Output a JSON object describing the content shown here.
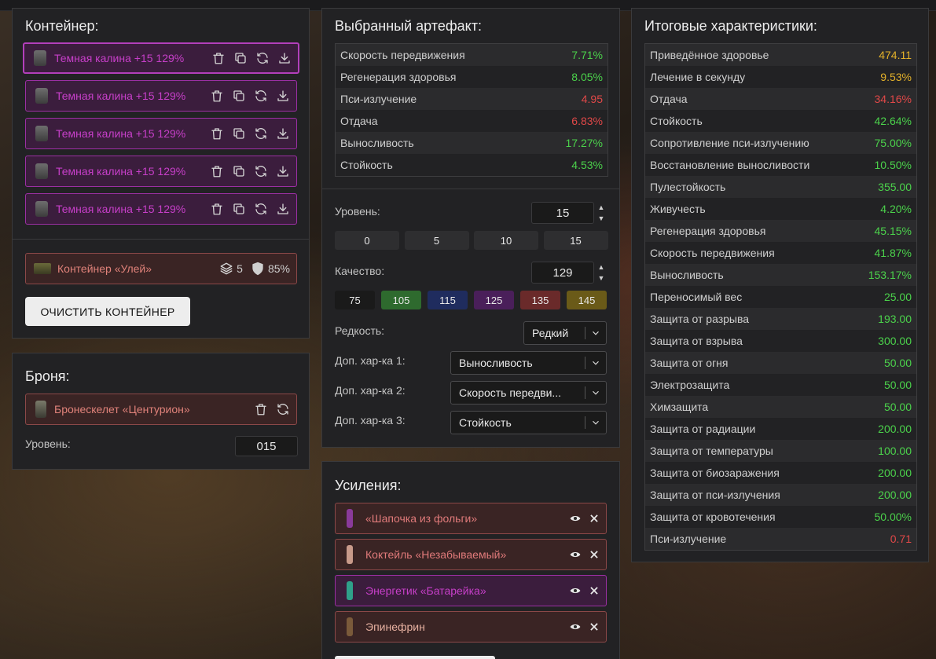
{
  "container": {
    "title": "Контейнер:",
    "items": [
      {
        "name": "Темная калина +15 129%"
      },
      {
        "name": "Темная калина +15 129%"
      },
      {
        "name": "Темная калина +15 129%"
      },
      {
        "name": "Темная калина +15 129%"
      },
      {
        "name": "Темная калина +15 129%"
      }
    ],
    "container_name": "Контейнер «Улей»",
    "slots": "5",
    "protection": "85%",
    "clear_button": "ОЧИСТИТЬ КОНТЕЙНЕР"
  },
  "armor": {
    "title": "Броня:",
    "name": "Бронескелет «Центурион»",
    "level_label": "Уровень:",
    "level_value": "015"
  },
  "artifact": {
    "title": "Выбранный артефакт:",
    "stats": [
      {
        "label": "Скорость передвижения",
        "value": "7.71%",
        "color": "green"
      },
      {
        "label": "Регенерация здоровья",
        "value": "8.05%",
        "color": "green"
      },
      {
        "label": "Пси-излучение",
        "value": "4.95",
        "color": "red"
      },
      {
        "label": "Отдача",
        "value": "6.83%",
        "color": "red"
      },
      {
        "label": "Выносливость",
        "value": "17.27%",
        "color": "green"
      },
      {
        "label": "Стойкость",
        "value": "4.53%",
        "color": "green"
      }
    ],
    "level_label": "Уровень:",
    "level_value": "15",
    "level_presets": [
      "0",
      "5",
      "10",
      "15"
    ],
    "quality_label": "Качество:",
    "quality_value": "129",
    "quality_presets": [
      {
        "label": "75",
        "color": "#1a1a1a"
      },
      {
        "label": "105",
        "color": "#2e6a2e"
      },
      {
        "label": "115",
        "color": "#1f2c5e"
      },
      {
        "label": "125",
        "color": "#4a1f5a"
      },
      {
        "label": "135",
        "color": "#6a2a2a"
      },
      {
        "label": "145",
        "color": "#6a5a18"
      }
    ],
    "rarity_label": "Редкость:",
    "rarity_value": "Редкий",
    "extra1_label": "Доп. хар-ка 1:",
    "extra1_value": "Выносливость",
    "extra2_label": "Доп. хар-ка 2:",
    "extra2_value": "Скорость передви...",
    "extra3_label": "Доп. хар-ка 3:",
    "extra3_value": "Стойкость"
  },
  "boosts": {
    "title": "Усиления:",
    "items": [
      {
        "name": "«Шапочка из фольги»",
        "bg": "#3a2424",
        "border": "#8b4848",
        "text": "#e07a7a",
        "thumb": "#8a3a9a"
      },
      {
        "name": "Коктейль «Незабываемый»",
        "bg": "#3a2424",
        "border": "#8b4848",
        "text": "#e07a7a",
        "thumb": "#c89a8a"
      },
      {
        "name": "Энергетик «Батарейка»",
        "bg": "#3b1d3d",
        "border": "#9b2fa3",
        "text": "#c73fc9",
        "thumb": "#2fa08a"
      },
      {
        "name": "Эпинефрин",
        "bg": "#3a2424",
        "border": "#8b4848",
        "text": "#e6b0a0",
        "thumb": "#7a5a3a"
      }
    ]
  },
  "totals": {
    "title": "Итоговые характеристики:",
    "stats": [
      {
        "label": "Приведённое здоровье",
        "value": "474.11",
        "color": "yellow"
      },
      {
        "label": "Лечение в секунду",
        "value": "9.53%",
        "color": "yellow"
      },
      {
        "label": "Отдача",
        "value": "34.16%",
        "color": "red"
      },
      {
        "label": "Стойкость",
        "value": "42.64%",
        "color": "green"
      },
      {
        "label": "Сопротивление пси-излучению",
        "value": "75.00%",
        "color": "green"
      },
      {
        "label": "Восстановление выносливости",
        "value": "10.50%",
        "color": "green"
      },
      {
        "label": "Пулестойкость",
        "value": "355.00",
        "color": "green"
      },
      {
        "label": "Живучесть",
        "value": "4.20%",
        "color": "green"
      },
      {
        "label": "Регенерация здоровья",
        "value": "45.15%",
        "color": "green"
      },
      {
        "label": "Скорость передвижения",
        "value": "41.87%",
        "color": "green"
      },
      {
        "label": "Выносливость",
        "value": "153.17%",
        "color": "green"
      },
      {
        "label": "Переносимый вес",
        "value": "25.00",
        "color": "green"
      },
      {
        "label": "Защита от разрыва",
        "value": "193.00",
        "color": "green"
      },
      {
        "label": "Защита от взрыва",
        "value": "300.00",
        "color": "green"
      },
      {
        "label": "Защита от огня",
        "value": "50.00",
        "color": "green"
      },
      {
        "label": "Электрозащита",
        "value": "50.00",
        "color": "green"
      },
      {
        "label": "Химзащита",
        "value": "50.00",
        "color": "green"
      },
      {
        "label": "Защита от радиации",
        "value": "200.00",
        "color": "green"
      },
      {
        "label": "Защита от температуры",
        "value": "100.00",
        "color": "green"
      },
      {
        "label": "Защита от биозаражения",
        "value": "200.00",
        "color": "green"
      },
      {
        "label": "Защита от пси-излучения",
        "value": "200.00",
        "color": "green"
      },
      {
        "label": "Защита от кровотечения",
        "value": "50.00%",
        "color": "green"
      },
      {
        "label": "Пси-излучение",
        "value": "0.71",
        "color": "red"
      }
    ]
  }
}
